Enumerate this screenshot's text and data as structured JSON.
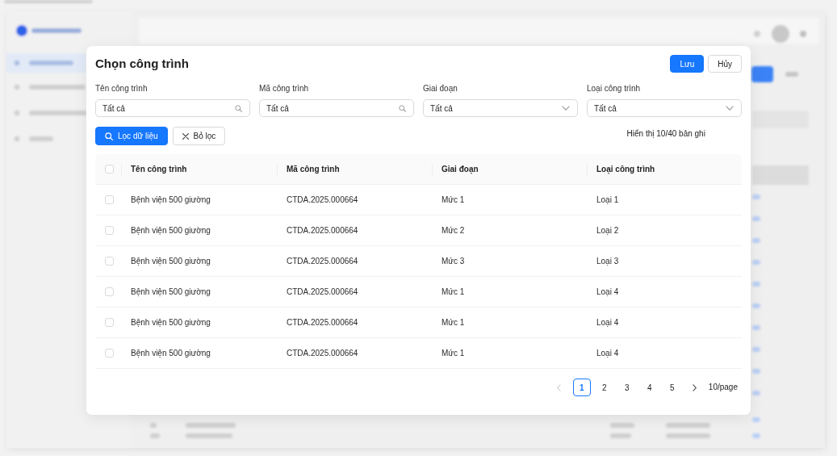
{
  "modal": {
    "title": "Chọn công trình",
    "actions": [
      {
        "label": "Lưu",
        "kind": "primary"
      },
      {
        "label": "Hủy",
        "kind": "default"
      }
    ]
  },
  "filters": [
    {
      "label": "Tên công trình",
      "kind": "search",
      "value": "Tất cả"
    },
    {
      "label": "Mã công trình",
      "kind": "search",
      "value": "Tất cả"
    },
    {
      "label": "Giai đoạn",
      "kind": "select",
      "value": "Tất cả"
    },
    {
      "label": "Loại công trình",
      "kind": "select",
      "value": "Tất cả"
    }
  ],
  "filter_buttons": [
    {
      "label": "Lọc dữ liệu",
      "kind": "apply"
    },
    {
      "label": "Bỏ lọc",
      "kind": "clear"
    }
  ],
  "record_count": "Hiển thị 10/40 bản ghi",
  "table": {
    "select_all_checked": false,
    "columns": [
      "Tên công trình",
      "Mã công trình",
      "Giai đoạn",
      "Loại công trình"
    ],
    "rows": [
      {
        "checked": false,
        "cells": [
          "Bệnh viện 500 giường",
          "CTDA.2025.000664",
          "Mức 1",
          "Loại 1"
        ]
      },
      {
        "checked": false,
        "cells": [
          "Bệnh viện 500 giường",
          "CTDA.2025.000664",
          "Mức 2",
          "Loại 2"
        ]
      },
      {
        "checked": false,
        "cells": [
          "Bệnh viện 500 giường",
          "CTDA.2025.000664",
          "Mức 3",
          "Loại 3"
        ]
      },
      {
        "checked": false,
        "cells": [
          "Bệnh viện 500 giường",
          "CTDA.2025.000664",
          "Mức 1",
          "Loại 4"
        ]
      },
      {
        "checked": false,
        "cells": [
          "Bệnh viện 500 giường",
          "CTDA.2025.000664",
          "Mức 1",
          "Loại 4"
        ]
      },
      {
        "checked": false,
        "cells": [
          "Bệnh viện 500 giường",
          "CTDA.2025.000664",
          "Mức 1",
          "Loại 4"
        ]
      }
    ]
  },
  "pagination": {
    "prev_disabled": true,
    "next_disabled": false,
    "pages": [
      {
        "label": "1",
        "selected": true
      },
      {
        "label": "2",
        "selected": false
      },
      {
        "label": "3",
        "selected": false
      },
      {
        "label": "4",
        "selected": false
      },
      {
        "label": "5",
        "selected": false
      }
    ],
    "page_size": "10/page"
  }
}
